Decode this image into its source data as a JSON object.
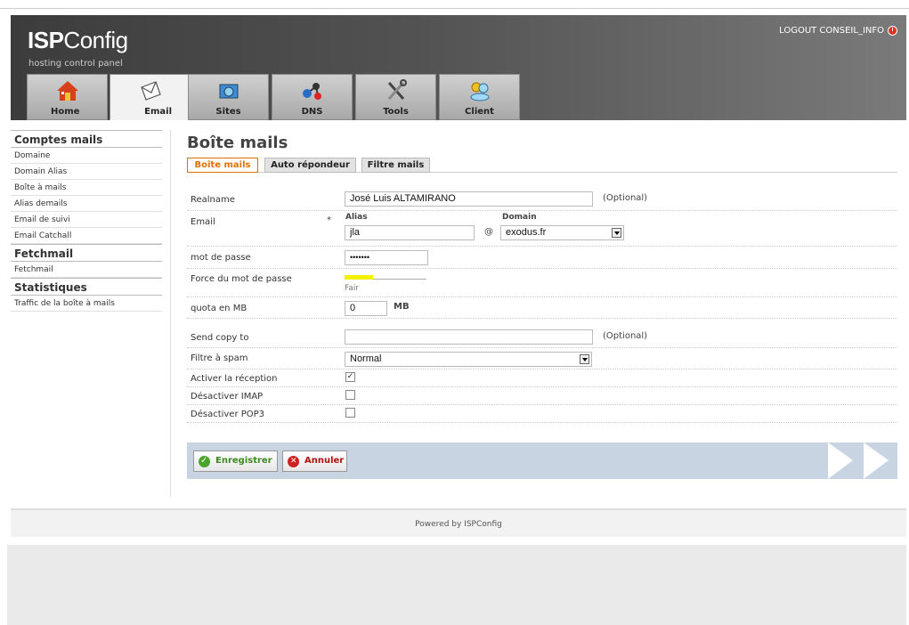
{
  "header": {
    "logo_bold": "ISP",
    "logo_rest": "Config",
    "tagline": "hosting control panel",
    "logout": "LOGOUT CONSEIL_INFO"
  },
  "tabs": [
    {
      "label": "Home",
      "icon": "home-icon"
    },
    {
      "label": "Email",
      "icon": "envelope-icon"
    },
    {
      "label": "Sites",
      "icon": "sites-icon"
    },
    {
      "label": "DNS",
      "icon": "dns-icon"
    },
    {
      "label": "Tools",
      "icon": "tools-icon"
    },
    {
      "label": "Client",
      "icon": "client-icon"
    }
  ],
  "sidebar": {
    "section1": "Comptes mails",
    "items1": [
      "Domaine",
      "Domain Alias",
      "Boîte à mails",
      "Alias demails",
      "Email de suivi",
      "Email Catchall"
    ],
    "section2": "Fetchmail",
    "items2": [
      "Fetchmail"
    ],
    "section3": "Statistiques",
    "items3": [
      "Traffic de la boîte à mails"
    ]
  },
  "page": {
    "title": "Boîte mails",
    "subtabs": [
      "Boîte mails",
      "Auto répondeur",
      "Filtre mails"
    ]
  },
  "form": {
    "realname_label": "Realname",
    "realname_value": "José Luis ALTAMIRANO",
    "optional": "(Optional)",
    "email_label": "Email",
    "required_mark": "*",
    "alias_label": "Alias",
    "alias_value": "jla",
    "at": "@",
    "domain_label": "Domain",
    "domain_value": "exodus.fr",
    "password_label": "mot de passe",
    "password_value": "•••••••",
    "strength_label": "Force du mot de passe",
    "strength_text": "Fair",
    "strength_level": 0.35,
    "quota_label": "quota en MB",
    "quota_value": "0",
    "quota_unit": "MB",
    "sendcopy_label": "Send copy to",
    "sendcopy_value": "",
    "spam_label": "Filtre à spam",
    "spam_value": "Normal",
    "receive_label": "Activer la réception",
    "receive_checked": true,
    "imap_label": "Désactiver IMAP",
    "imap_checked": false,
    "pop3_label": "Désactiver POP3",
    "pop3_checked": false
  },
  "buttons": {
    "save": "Enregistrer",
    "cancel": "Annuler"
  },
  "footer": {
    "text": "Powered by ISPConfig"
  },
  "colors": {
    "active_tab": "#e07000",
    "strength_bar": "#f5f000",
    "button_bar": "#c8d4e2"
  }
}
